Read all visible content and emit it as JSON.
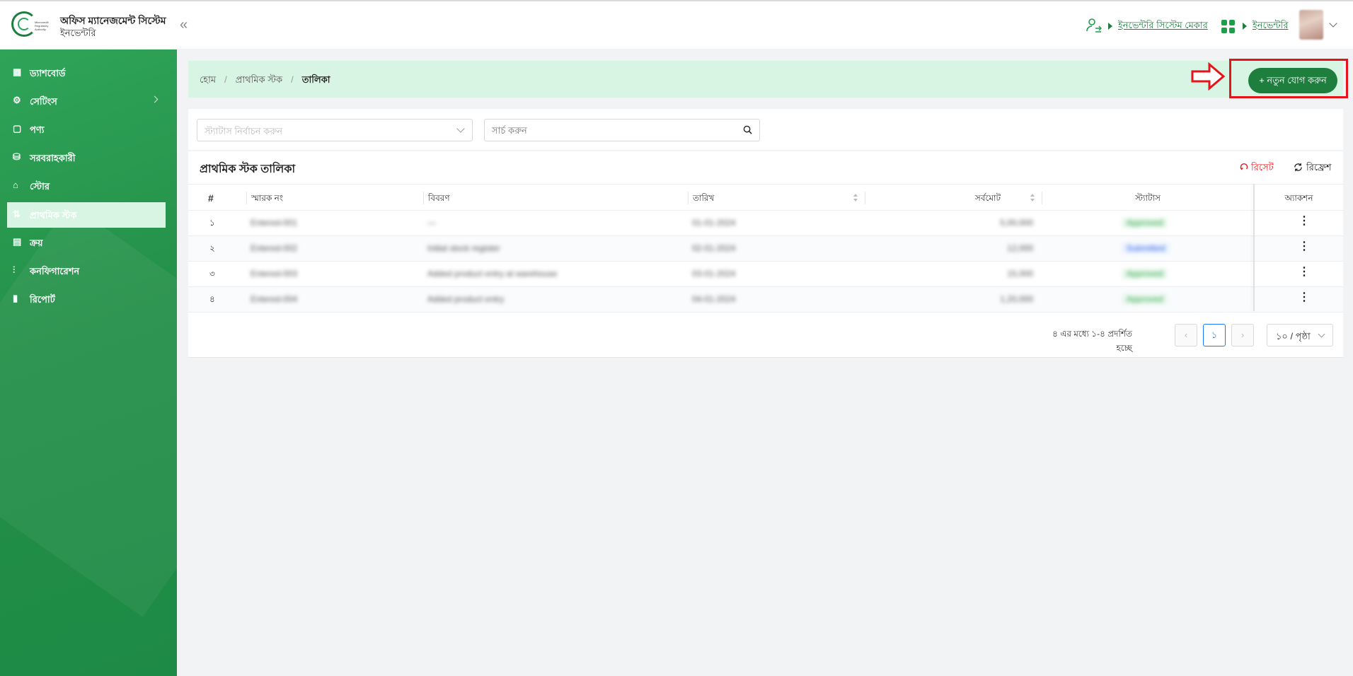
{
  "header": {
    "app_title": "অফিস ম্যানেজমেন্ট সিস্টেম",
    "app_subtitle": "ইনভেন্টরি",
    "collapse_icon": "«",
    "role_link": "ইনভেন্টরি সিস্টেম মেকার",
    "module_link": "ইনভেন্টরি",
    "logo_text": "Microcredit Regulatory Authority"
  },
  "sidebar": {
    "items": [
      {
        "label": "ড্যাশবোর্ড",
        "icon": "dashboard-icon",
        "glyph": "▦"
      },
      {
        "label": "সেটিংস",
        "icon": "gear-icon",
        "glyph": "⚙"
      },
      {
        "label": "পণ্য",
        "icon": "product-icon",
        "glyph": "▢"
      },
      {
        "label": "সরবরাহকারী",
        "icon": "supplier-icon",
        "glyph": "⛁"
      },
      {
        "label": "স্টোর",
        "icon": "store-icon",
        "glyph": "⌂"
      },
      {
        "label": "প্রাথমিক স্টক",
        "icon": "stock-icon",
        "glyph": "⇅"
      },
      {
        "label": "ক্রয়",
        "icon": "purchase-icon",
        "glyph": "▤"
      },
      {
        "label": "কনফিগারেশন",
        "icon": "sliders-icon",
        "glyph": "⫶"
      },
      {
        "label": "রিপোর্ট",
        "icon": "report-icon",
        "glyph": "▮"
      }
    ],
    "active_index": 5
  },
  "breadcrumb": {
    "home": "হোম",
    "section": "প্রাথমিক স্টক",
    "current": "তালিকা"
  },
  "add_button": "+ নতুন যোগ করুন",
  "filters": {
    "status_placeholder": "স্ট্যাটাস নির্বাচন করুন",
    "search_placeholder": "সার্চ করুন"
  },
  "table": {
    "title": "প্রাথমিক স্টক তালিকা",
    "reset_label": "রিসেট",
    "refresh_label": "রিফ্রেশ",
    "columns": [
      "#",
      "স্মারক নং",
      "বিবরণ",
      "তারিখ",
      "সর্বমোট",
      "স্ট্যাটাস",
      "অ্যাকশন"
    ],
    "rows": [
      {
        "num": "১",
        "memo": "Entered-001",
        "desc": "—",
        "date": "01-01-2024",
        "total": "5,00,000",
        "status": "Approved",
        "status_color": "green"
      },
      {
        "num": "২",
        "memo": "Entered-002",
        "desc": "Initial stock register",
        "date": "02-01-2024",
        "total": "12,000",
        "status": "Submitted",
        "status_color": "blue"
      },
      {
        "num": "৩",
        "memo": "Entered-003",
        "desc": "Added product entry at warehouse",
        "date": "03-01-2024",
        "total": "15,000",
        "status": "Approved",
        "status_color": "green"
      },
      {
        "num": "৪",
        "memo": "Entered-004",
        "desc": "Added product entry",
        "date": "04-01-2024",
        "total": "1,20,000",
        "status": "Approved",
        "status_color": "green"
      }
    ]
  },
  "pagination": {
    "info": "৪ এর মধ্যে ১-৪ প্রদর্শিত হচ্ছে",
    "current_page": "১",
    "page_size": "১০ / পৃষ্ঠা"
  },
  "colors": {
    "brand_green": "#1e7e3e",
    "sidebar_green": "#249049",
    "highlight_red": "#e5141a",
    "crumb_bg": "#d7f5e2"
  }
}
